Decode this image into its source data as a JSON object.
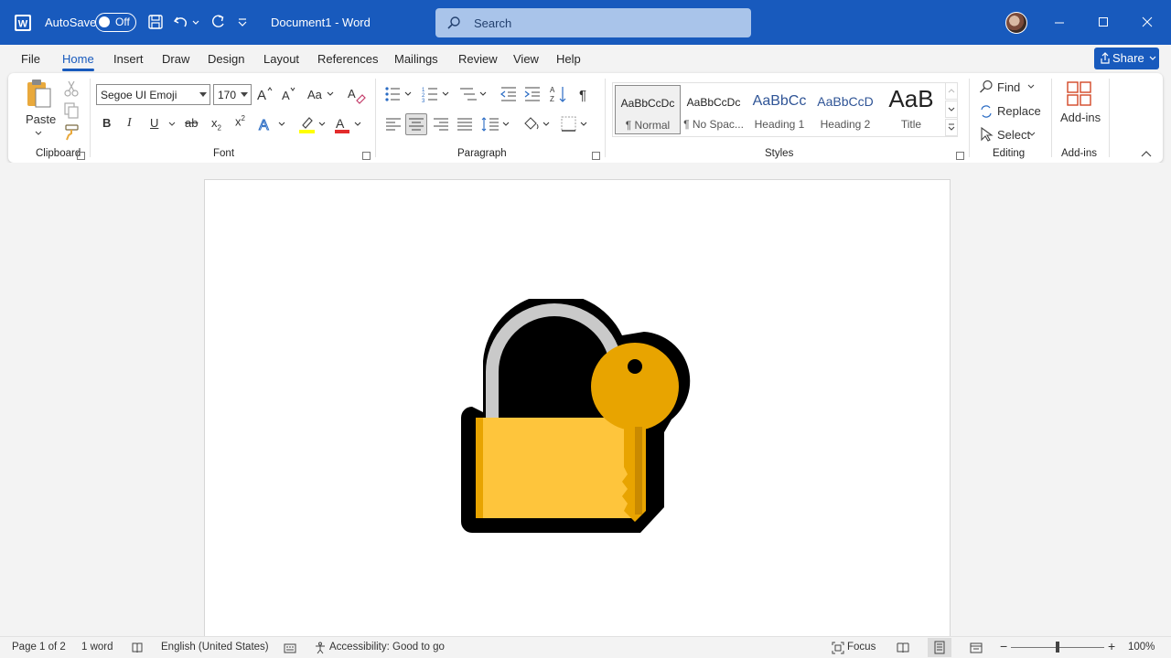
{
  "titlebar": {
    "autosave_label": "AutoSave",
    "autosave_state": "Off",
    "document_title": "Document1  -  Word",
    "search_placeholder": "Search"
  },
  "tabs": [
    "File",
    "Home",
    "Insert",
    "Draw",
    "Design",
    "Layout",
    "References",
    "Mailings",
    "Review",
    "View",
    "Help"
  ],
  "active_tab": "Home",
  "share_label": "Share",
  "ribbon": {
    "clipboard": {
      "paste_label": "Paste",
      "group_label": "Clipboard"
    },
    "font": {
      "font_name": "Segoe UI Emoji",
      "font_size": "170",
      "group_label": "Font"
    },
    "paragraph": {
      "group_label": "Paragraph"
    },
    "styles": {
      "group_label": "Styles",
      "items": [
        {
          "preview": "AaBbCcDc",
          "name": "¶ Normal"
        },
        {
          "preview": "AaBbCcDc",
          "name": "¶ No Spac..."
        },
        {
          "preview": "AaBbCc",
          "name": "Heading 1"
        },
        {
          "preview": "AaBbCcD",
          "name": "Heading 2"
        },
        {
          "preview": "AaB",
          "name": "Title"
        }
      ]
    },
    "editing": {
      "find_label": "Find",
      "replace_label": "Replace",
      "select_label": "Select",
      "group_label": "Editing"
    },
    "addins": {
      "label": "Add-ins",
      "group_label": "Add-ins"
    }
  },
  "document": {
    "content_icon": "locked-with-key-emoji"
  },
  "status": {
    "page": "Page 1 of 2",
    "words": "1 word",
    "language": "English (United States)",
    "accessibility": "Accessibility: Good to go",
    "focus": "Focus",
    "zoom": "100%"
  },
  "colors": {
    "word_blue": "#185abd",
    "lock_gold": "#fec53c",
    "key_gold": "#e8a400"
  }
}
